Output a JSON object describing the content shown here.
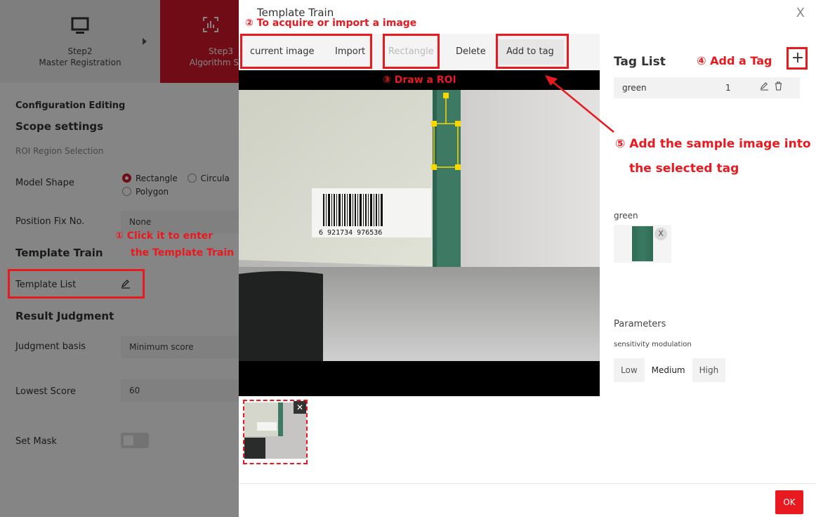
{
  "steps": [
    {
      "label1": "Step2",
      "label2": "Master Registration"
    },
    {
      "label1": "Step3",
      "label2": "Algorithm S"
    }
  ],
  "config": {
    "editing_title": "Configuration Editing",
    "scope_title": "Scope settings",
    "roi_label": "ROI Region Selection",
    "model_shape_label": "Model Shape",
    "shape_options": [
      "Rectangle",
      "Circula",
      "Polygon"
    ],
    "position_fix_label": "Position Fix No.",
    "position_fix_value": "None",
    "template_train_title": "Template Train",
    "template_list_label": "Template List",
    "result_title": "Result Judgment",
    "judgment_basis_label": "Judgment basis",
    "judgment_basis_value": "Minimum score",
    "lowest_score_label": "Lowest Score",
    "lowest_score_value": "60",
    "set_mask_label": "Set Mask"
  },
  "annotations": {
    "a1": "① Click it to enter",
    "a1b": "the Template Train",
    "a2": "② To acquire or import a image",
    "a3": "③ Draw a ROI",
    "a4": "④ Add a Tag",
    "a5": "⑤ Add the sample image into",
    "a5b": "the selected tag"
  },
  "modal": {
    "title": "Template Train",
    "close": "X",
    "toolbar": {
      "current_image": "current image",
      "import": "Import",
      "rectangle": "Rectangle",
      "delete": "Delete",
      "add_to_tag": "Add to tag"
    },
    "thumb_close": "✕",
    "tag_list_title": "Tag List",
    "add_tag_symbol": "+",
    "tags": [
      {
        "name": "green",
        "count": "1"
      }
    ],
    "sample_section": "green",
    "sample_close": "X",
    "parameters_title": "Parameters",
    "sensitivity_label": "sensitivity modulation",
    "sensitivity_options": [
      "Low",
      "Medium",
      "High"
    ],
    "sensitivity_selected": "Medium",
    "ok_label": "OK"
  },
  "image": {
    "barcode_digits": "6 921734 976536"
  }
}
